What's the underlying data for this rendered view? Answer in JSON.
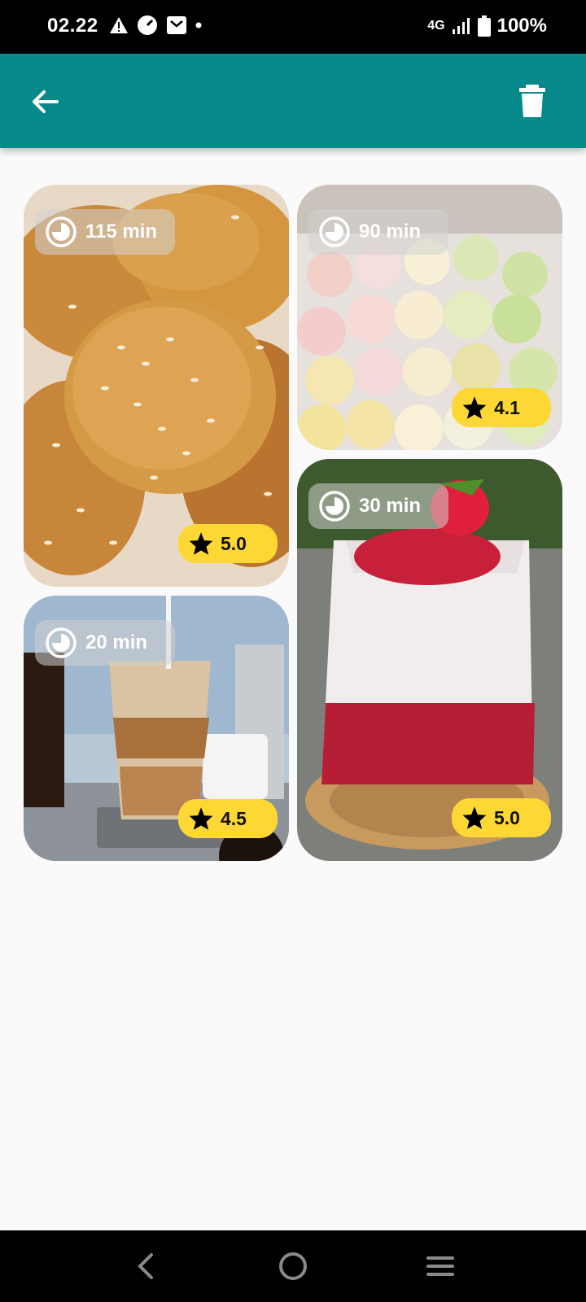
{
  "status_bar": {
    "time": "02.22",
    "network": "4G",
    "battery": "100%",
    "icons": [
      "warning-icon",
      "speedometer-icon",
      "mail-icon",
      "dot-icon",
      "signal-icon",
      "battery-icon"
    ]
  },
  "app_bar": {
    "color": "#06898a",
    "icons": [
      "back-arrow-icon",
      "trash-icon"
    ]
  },
  "recipes": [
    {
      "name_icon": "sesame-bread",
      "time": "115 min",
      "rating": "5.0"
    },
    {
      "name_icon": "mochi",
      "time": "90 min",
      "rating": "4.1"
    },
    {
      "name_icon": "iced-coffee",
      "time": "20 min",
      "rating": "4.5"
    },
    {
      "name_icon": "strawberry-milk",
      "time": "30 min",
      "rating": "5.0"
    }
  ],
  "rating_color": "#fdd835",
  "nav_bar": {
    "icons": [
      "nav-back-icon",
      "nav-home-icon",
      "nav-menu-icon"
    ]
  }
}
